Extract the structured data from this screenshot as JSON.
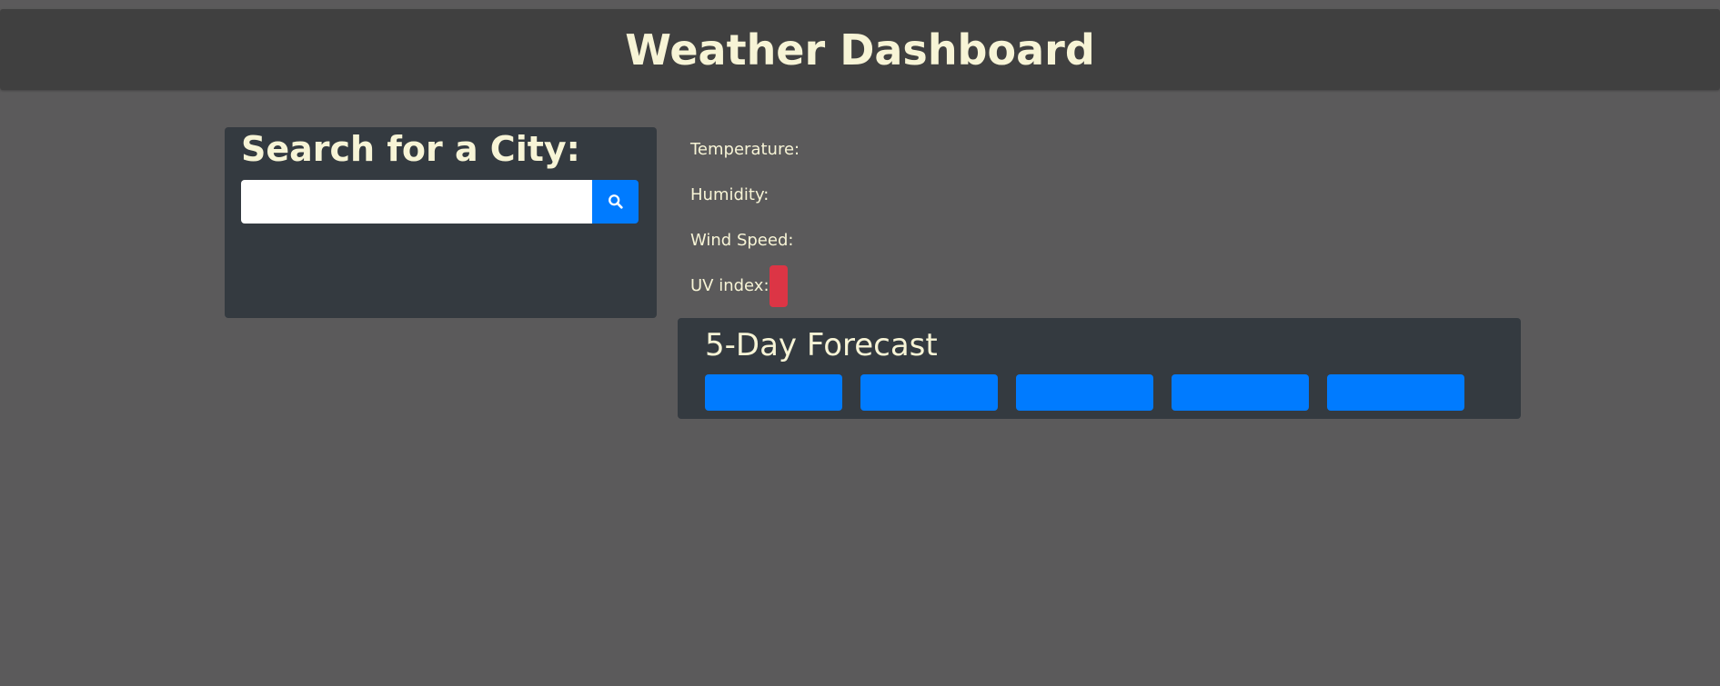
{
  "header": {
    "title": "Weather Dashboard"
  },
  "search": {
    "heading": "Search for a City:",
    "input_value": "",
    "placeholder": "",
    "button_icon": "search-icon"
  },
  "current": {
    "temperature_label": "Temperature:",
    "humidity_label": "Humidity:",
    "wind_label": "Wind Speed:",
    "uv_label": "UV index:"
  },
  "forecast": {
    "heading": "5-Day Forecast",
    "cards": [
      {},
      {},
      {},
      {},
      {}
    ]
  },
  "colors": {
    "background": "#5b5a5b",
    "header": "#404040",
    "panel": "#343a40",
    "accent": "#007bff",
    "uv_badge": "#dc3545",
    "text": "#f7f4d6"
  }
}
